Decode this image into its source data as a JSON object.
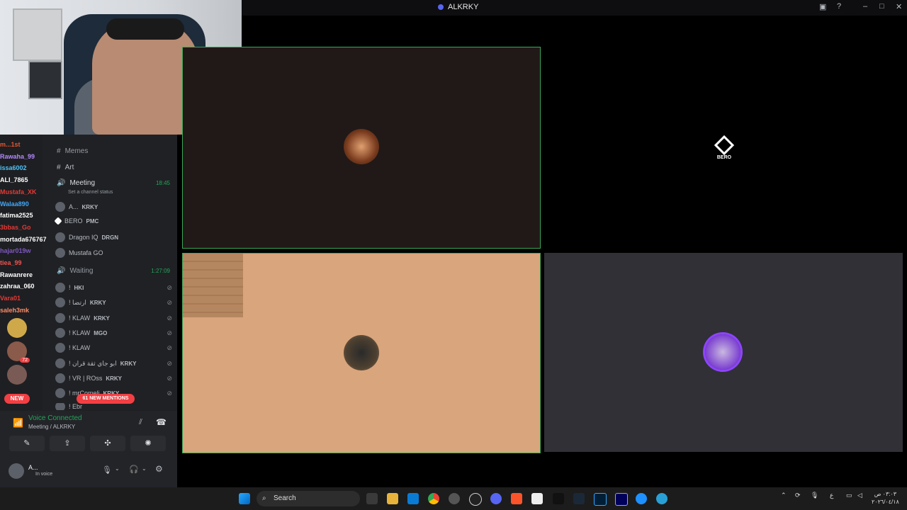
{
  "window": {
    "title": "ALKRKY"
  },
  "chat": [
    {
      "user": "m...1st",
      "color": "#e4572e"
    },
    {
      "user": "Rawaha_99",
      "color": "#b388ff"
    },
    {
      "user": "issa6002",
      "color": "#4fc3f7"
    },
    {
      "user": "ALI_7865",
      "color": "#ffffff"
    },
    {
      "user": "Mustafa_XK",
      "color": "#e53935"
    },
    {
      "user": "Walaa890",
      "color": "#42a5f5"
    },
    {
      "user": "fatima2525",
      "color": "#ffffff"
    },
    {
      "user": "3bbas_Go",
      "color": "#e53935"
    },
    {
      "user": "mortada676767",
      "color": "#ffffff"
    },
    {
      "user": "hajar019w",
      "color": "#7e57c2"
    },
    {
      "user": "tiea_99",
      "color": "#ef5350"
    },
    {
      "user": "Rawanrere",
      "color": "#ffffff"
    },
    {
      "user": "zahraa_060",
      "color": "#ffffff"
    },
    {
      "user": "Vara01",
      "color": "#e53935"
    },
    {
      "user": "saleh3mk",
      "color": "#ff8a65"
    }
  ],
  "channels": {
    "memes": "Memes",
    "art": "Art",
    "meeting": "Meeting",
    "meeting_time": "18:45",
    "channel_status": "Set a channel status",
    "waiting": "Waiting",
    "waiting_time": "1:27:09"
  },
  "meeting_users": [
    {
      "name": "A...",
      "tag": "KRKY"
    },
    {
      "name": "BERO",
      "tag": "PMC"
    },
    {
      "name": "Dragon IQ",
      "tag": "DRGN"
    },
    {
      "name": "Mustafa GO",
      "tag": ""
    }
  ],
  "waiting_users": [
    {
      "name": "!",
      "tag": "HKI"
    },
    {
      "name": "! ارتضا",
      "tag": "KRKY"
    },
    {
      "name": "! KLAW",
      "tag": "KRKY"
    },
    {
      "name": "! KLAW",
      "tag": "MGO"
    },
    {
      "name": "! KLAW",
      "tag": ""
    },
    {
      "name": "! ابو جاي ثقة قران",
      "tag": "KRKY"
    },
    {
      "name": "! VR | ROss",
      "tag": "KRKY"
    },
    {
      "name": "! mrComeli",
      "tag": "KRKY"
    },
    {
      "name": "! Ebr",
      "tag": ""
    }
  ],
  "mentions": "61 NEW MENTIONS",
  "server_badges": {
    "new": "NEW",
    "count": "72"
  },
  "voice": {
    "status": "Voice Connected",
    "location": "Meeting / ALKRKY"
  },
  "user": {
    "name": "A...",
    "status": "In voice"
  },
  "stage": {
    "bero_label": "BERO"
  },
  "taskbar": {
    "search": "Search",
    "clock_time": "٠٣:٠٣ ص",
    "clock_date": "٢٠٢٦/٠٤/١٨",
    "lang": "ع"
  }
}
